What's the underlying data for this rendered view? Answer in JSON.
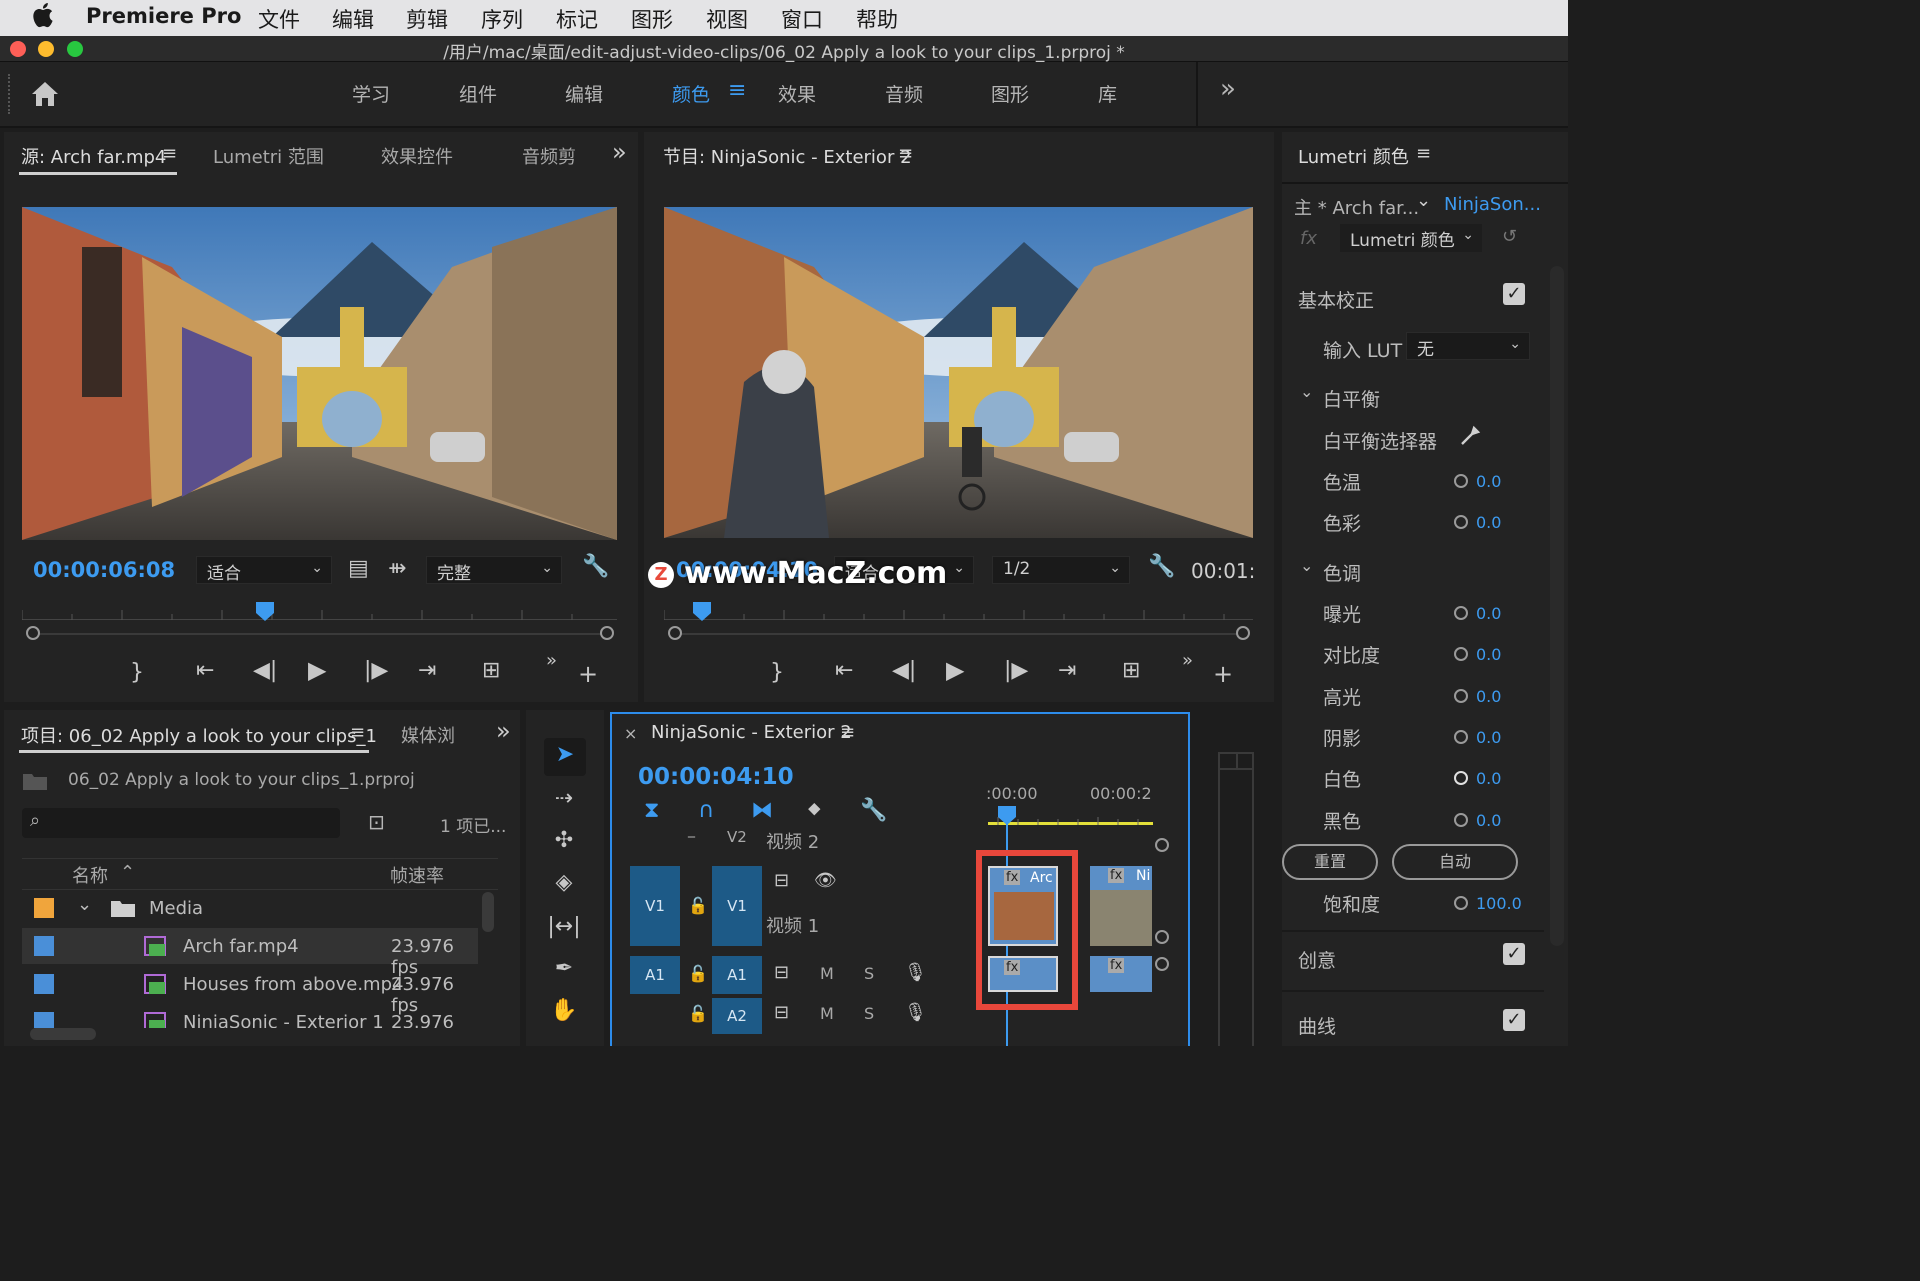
{
  "menubar": {
    "app_name": "Premiere Pro",
    "items": [
      "文件",
      "编辑",
      "剪辑",
      "序列",
      "标记",
      "图形",
      "视图",
      "窗口",
      "帮助"
    ]
  },
  "window": {
    "title": "/用户/mac/桌面/edit-adjust-video-clips/06_02 Apply a look to your clips_1.prproj *"
  },
  "workspaces": {
    "tabs": [
      "学习",
      "组件",
      "编辑",
      "颜色",
      "效果",
      "音频",
      "图形",
      "库"
    ],
    "active": "颜色",
    "menu_icon": "≡",
    "overflow": "»"
  },
  "source_panel": {
    "tabs": [
      "源: Arch far.mp4",
      "Lumetri 范围",
      "效果控件",
      "音频剪"
    ],
    "active_menu": "≡",
    "timecode": "00:00:06:08",
    "fit_select": "适合",
    "quality_select": "完整"
  },
  "program_panel": {
    "title": "节目: NinjaSonic - Exterior 2",
    "timecode": "00:00:04:10",
    "fit_select": "适合",
    "quality_select": "1/2",
    "duration": "00:01:"
  },
  "watermark": {
    "text": "www.MacZ.com",
    "badge": "Z"
  },
  "project_panel": {
    "tab": "项目: 06_02 Apply a look to your clips_1",
    "tab2": "媒体浏",
    "file": "06_02 Apply a look to your clips_1.prproj",
    "search_placeholder": "",
    "item_count": "1 项已...",
    "col_name": "名称",
    "col_fps": "帧速率",
    "rows": [
      {
        "name": "Media",
        "fps": "",
        "color": "#f0a53c",
        "type": "folder"
      },
      {
        "name": "Arch far.mp4",
        "fps": "23.976 fps",
        "color": "#4a8fd8",
        "type": "clip"
      },
      {
        "name": "Houses from above.mp4",
        "fps": "23.976 fps",
        "color": "#4a8fd8",
        "type": "clip"
      },
      {
        "name": "NinjaSonic - Exterior 1",
        "fps": "23.976 fps",
        "color": "#4a8fd8",
        "type": "clip"
      }
    ]
  },
  "timeline": {
    "title": "NinjaSonic - Exterior 2",
    "timecode": "00:00:04:10",
    "ruler_start": ":00:00",
    "ruler_next": "00:00:2",
    "tracks": {
      "v2": "V2",
      "v2_name": "视频 2",
      "v1": "V1",
      "v1_name": "视频 1",
      "a1": "A1",
      "a2": "A2",
      "m": "M",
      "s": "S"
    },
    "clip1_label": "Arc",
    "clip2_label": "Ni",
    "fx": "fx"
  },
  "lumetri": {
    "title": "Lumetri 颜色",
    "master_clip": "主 * Arch far...",
    "sequence_clip": "NinjaSon...",
    "effect_select": "Lumetri 颜色",
    "basic": "基本校正",
    "input_lut_label": "输入 LUT",
    "input_lut_value": "无",
    "white_balance": "白平衡",
    "wb_picker": "白平衡选择器",
    "temp_label": "色温",
    "temp_value": "0.0",
    "tint_label": "色彩",
    "tint_value": "0.0",
    "tone": "色调",
    "exposure_label": "曝光",
    "exposure_value": "0.0",
    "contrast_label": "对比度",
    "contrast_value": "0.0",
    "highlights_label": "高光",
    "highlights_value": "0.0",
    "shadows_label": "阴影",
    "shadows_value": "0.0",
    "whites_label": "白色",
    "whites_value": "0.0",
    "blacks_label": "黑色",
    "blacks_value": "0.0",
    "reset_button": "重置",
    "auto_button": "自动",
    "saturation_label": "饱和度",
    "saturation_value": "100.0",
    "creative": "创意",
    "curves": "曲线"
  },
  "colors": {
    "accent": "#3d9bf0",
    "highlight_box": "#e8473b",
    "track_blue": "#1d5a87",
    "clip_blue": "#5b8fc7"
  }
}
